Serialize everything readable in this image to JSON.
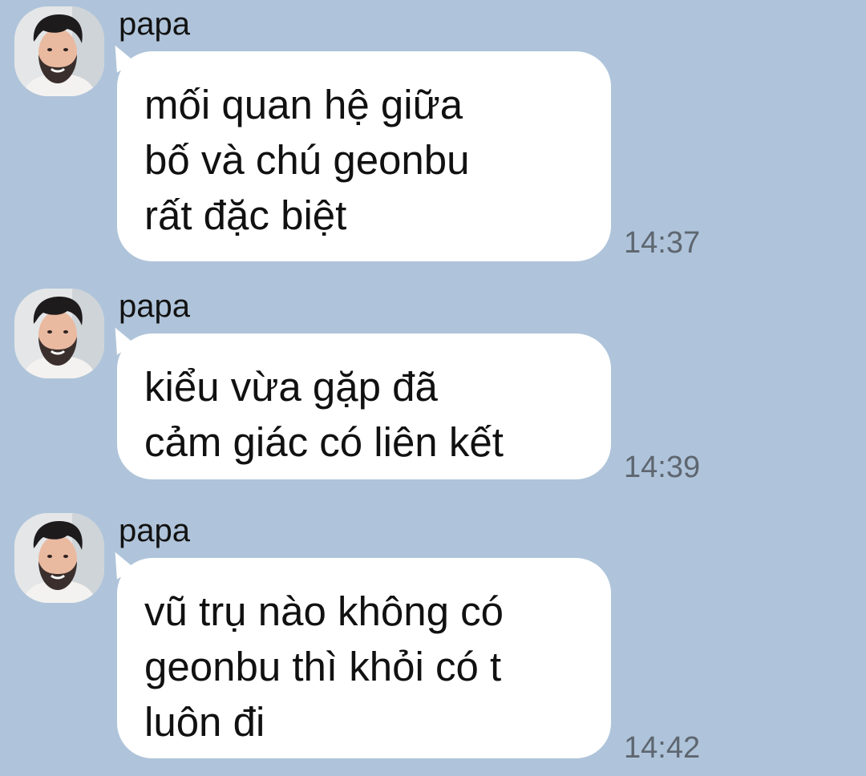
{
  "messages": [
    {
      "sender": "papa",
      "text": "mối quan hệ giữa\nbố và chú geonbu\nrất đặc biệt",
      "time": "14:37"
    },
    {
      "sender": "papa",
      "text": "kiểu vừa gặp đã\ncảm giác có liên kết",
      "time": "14:39"
    },
    {
      "sender": "papa",
      "text": "vũ trụ nào không có\ngeonbu thì khỏi có t\nluôn đi",
      "time": "14:42"
    }
  ],
  "colors": {
    "background": "#afc4da",
    "bubble": "#ffffff",
    "timestamp": "#5e6670"
  },
  "icons": {
    "avatar": "user-avatar-photo"
  }
}
